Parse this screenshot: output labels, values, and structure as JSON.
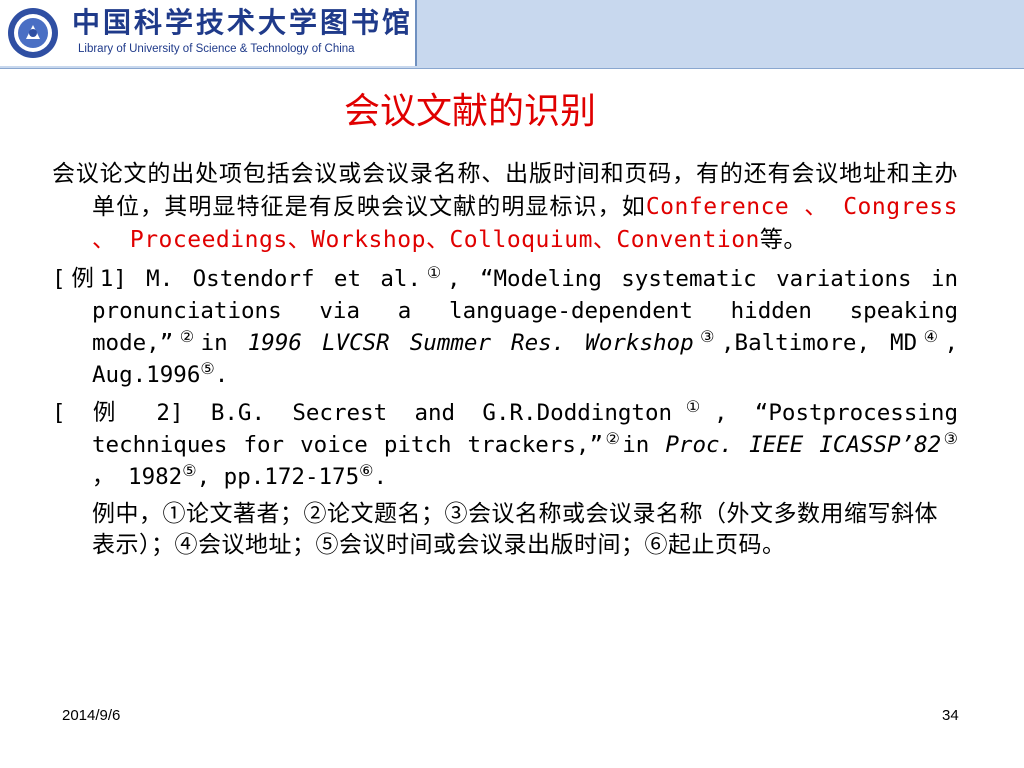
{
  "header": {
    "library_name_cn": "中国科学技术大学图书馆",
    "library_name_en": "Library of University of Science & Technology of China",
    "seal_icon": "university-seal-icon",
    "banner_color": "#c8d8ee",
    "brand_color": "#1f3a8a"
  },
  "title": "会议文献的识别",
  "title_color": "#e00000",
  "intro": {
    "text": "会议论文的出处项包括会议或会议录名称、出版时间和页码，有的还有会议地址和主办单位，其明显特征是有反映会议文献的明显标识，如",
    "keywords": "Conference 、 Congress 、 Proceedings、Workshop、Colloquium、Convention",
    "ending": "等。"
  },
  "example1": {
    "label": "[例1]",
    "author": " M. Ostendorf et al.",
    "m1": "①",
    "p1": ", “Modeling systematic variations in pronunciations via a language-dependent hidden speaking mode,”",
    "m2": "②",
    "p2": "in ",
    "conf": "1996 LVCSR Summer Res. Workshop",
    "m3": "③",
    "p3": ",Baltimore, MD",
    "m4": "④",
    "p4": ", Aug.1996",
    "m5": "⑤",
    "p5": "."
  },
  "example2": {
    "label": "[ 例 2]",
    "author": " B.G. Secrest and G.R.Doddington",
    "m1": "①",
    "p1": ", “Postprocessing techniques for voice pitch trackers,”",
    "m2": "②",
    "p2": "in ",
    "conf": "Proc. IEEE ICASSP’82",
    "m3": "③",
    "p3": " ， 1982",
    "m5": "⑤",
    "p5": ", pp.172-175",
    "m6": "⑥",
    "p6": "."
  },
  "explanation": "例中，①论文著者；②论文题名；③会议名称或会议录名称（外文多数用缩写斜体表示）；④会议地址；⑤会议时间或会议录出版时间；⑥起止页码。",
  "footer": {
    "date": "2014/9/6",
    "page": "34"
  }
}
